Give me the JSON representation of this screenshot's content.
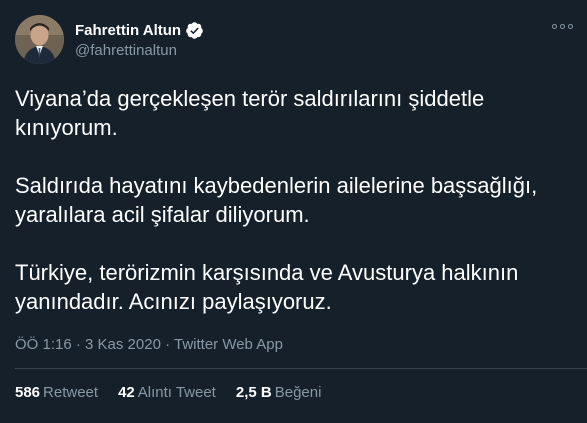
{
  "author": {
    "name": "Fahrettin Altun",
    "handle": "@fahrettinaltun",
    "verified": true
  },
  "tweet": {
    "paragraphs": [
      "Viyana’da gerçekleşen terör saldırılarını şiddetle kınıyorum.",
      "Saldırıda hayatını kaybedenlerin ailelerine başsağlığı, yaralılara acil şifalar diliyorum.",
      "Türkiye, terörizmin karşısında ve Avusturya halkının yanındadır. Acınızı paylaşıyoruz."
    ]
  },
  "meta": {
    "timestamp": "ÖÖ 1:16 · 3 Kas 2020 · ",
    "app": "Twitter Web App"
  },
  "stats": {
    "retweets": {
      "count": "586",
      "label": "Retweet"
    },
    "quotes": {
      "count": "42",
      "label": "Alıntı Tweet"
    },
    "likes": {
      "count": "2,5 B",
      "label": "Beğeni"
    }
  },
  "colors": {
    "background": "#15202b",
    "secondary_text": "#8899a6",
    "verified_blue": "#1da1f2",
    "divider": "#38444d"
  },
  "icons": {
    "verified": "verified-badge-icon",
    "more": "more-options-icon"
  }
}
